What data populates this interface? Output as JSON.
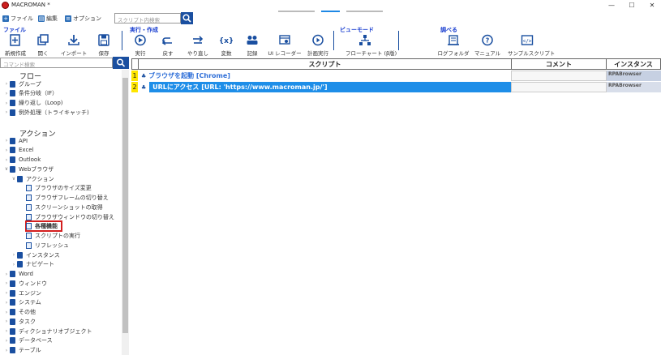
{
  "window": {
    "title": "MACROMAN *"
  },
  "window_controls": {
    "minimize": "—",
    "maximize": "☐",
    "close": "✕"
  },
  "menu": {
    "file": "ファイル",
    "edit": "編集",
    "options": "オプション"
  },
  "search": {
    "placeholder": "スクリプト内検索"
  },
  "ribbon": {
    "groups": {
      "file": "ファイル",
      "run_create": "実行・作成",
      "view_mode": "ビューモード",
      "look_up": "調べる"
    },
    "buttons": {
      "new": "新規作成",
      "open": "開く",
      "import": "インポート",
      "save": "保存",
      "run": "実行",
      "undo": "戻す",
      "redo": "やり直し",
      "variables": "変数",
      "record": "記録",
      "ui_recorder": "UI レコーダー",
      "scheduled_run": "計画実行",
      "flowchart": "フローチャート (β版)",
      "log_folder": "ログフォルダ",
      "manual": "マニュアル",
      "sample_scripts": "サンプルスクリプト"
    }
  },
  "command_search": {
    "placeholder": "コマンド検索"
  },
  "tree": {
    "flow_title": "フロー",
    "flow_items": [
      "グループ",
      "条件分岐（IF）",
      "繰り返し（Loop)",
      "例外処理（トライキャッチ)"
    ],
    "action_title": "アクション",
    "action_top": [
      "API",
      "Excel",
      "Outlook",
      "Webブラウザ"
    ],
    "web_sub": "アクション",
    "web_actions": [
      "ブラウザのサイズ変更",
      "ブラウザフレームの切り替え",
      "スクリーンショットの取得",
      "ブラウザウィンドウの切り替え",
      "各種機能",
      "スクリプトの実行",
      "リフレッシュ"
    ],
    "web_rest": [
      "インスタンス",
      "ナビゲート"
    ],
    "more": [
      "Word",
      "ウィンドウ",
      "エンジン",
      "システム",
      "その他",
      "タスク",
      "ディクショナリオブジェクト",
      "データベース",
      "テーブル"
    ]
  },
  "grid": {
    "headers": {
      "script": "スクリプト",
      "comment": "コメント",
      "instance": "インスタンス"
    },
    "rows": [
      {
        "num": "1",
        "script": "ブラウザを起動 [Chrome]",
        "comment": "",
        "instance": "RPABrowser"
      },
      {
        "num": "2",
        "script": "URLにアクセス [URL: 'https://www.macroman.jp/']",
        "comment": "",
        "instance": "RPABrowser"
      }
    ]
  },
  "colors": {
    "accent": "#1a4fa0",
    "selected_row": "#1e8ee8",
    "highlight": "#d31f1f",
    "row_number": "#ffe600"
  }
}
